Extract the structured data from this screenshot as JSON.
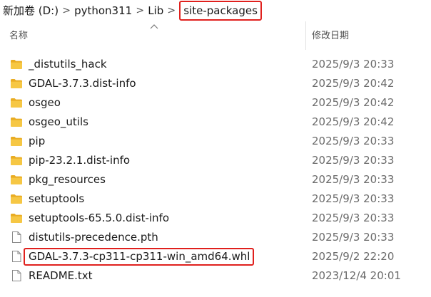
{
  "breadcrumb": {
    "items": [
      {
        "label": "新加卷 (D:)"
      },
      {
        "label": "python311"
      },
      {
        "label": "Lib"
      },
      {
        "label": "site-packages"
      }
    ],
    "separator": ">"
  },
  "columns": {
    "name": "名称",
    "date_modified": "修改日期",
    "sort_indicator": "ascending"
  },
  "colors": {
    "highlight_border": "#e0201d",
    "folder_fill": "#f3c13a",
    "date_text": "#6b6b6b"
  },
  "files": [
    {
      "name": "_distutils_hack",
      "date": "2025/9/3 20:33",
      "type": "folder",
      "icon": "folder-icon"
    },
    {
      "name": "GDAL-3.7.3.dist-info",
      "date": "2025/9/3 20:42",
      "type": "folder",
      "icon": "folder-icon"
    },
    {
      "name": "osgeo",
      "date": "2025/9/3 20:42",
      "type": "folder",
      "icon": "folder-icon"
    },
    {
      "name": "osgeo_utils",
      "date": "2025/9/3 20:42",
      "type": "folder",
      "icon": "folder-icon"
    },
    {
      "name": "pip",
      "date": "2025/9/3 20:33",
      "type": "folder",
      "icon": "folder-icon"
    },
    {
      "name": "pip-23.2.1.dist-info",
      "date": "2025/9/3 20:33",
      "type": "folder",
      "icon": "folder-icon"
    },
    {
      "name": "pkg_resources",
      "date": "2025/9/3 20:33",
      "type": "folder",
      "icon": "folder-icon"
    },
    {
      "name": "setuptools",
      "date": "2025/9/3 20:33",
      "type": "folder",
      "icon": "folder-icon"
    },
    {
      "name": "setuptools-65.5.0.dist-info",
      "date": "2025/9/3 20:33",
      "type": "folder",
      "icon": "folder-icon"
    },
    {
      "name": "distutils-precedence.pth",
      "date": "2025/9/3 20:33",
      "type": "file",
      "icon": "file-icon"
    },
    {
      "name": "GDAL-3.7.3-cp311-cp311-win_amd64.whl",
      "date": "2025/9/2 22:20",
      "type": "file",
      "icon": "file-icon",
      "highlighted": true
    },
    {
      "name": "README.txt",
      "date": "2023/12/4 20:01",
      "type": "file",
      "icon": "file-icon"
    }
  ]
}
